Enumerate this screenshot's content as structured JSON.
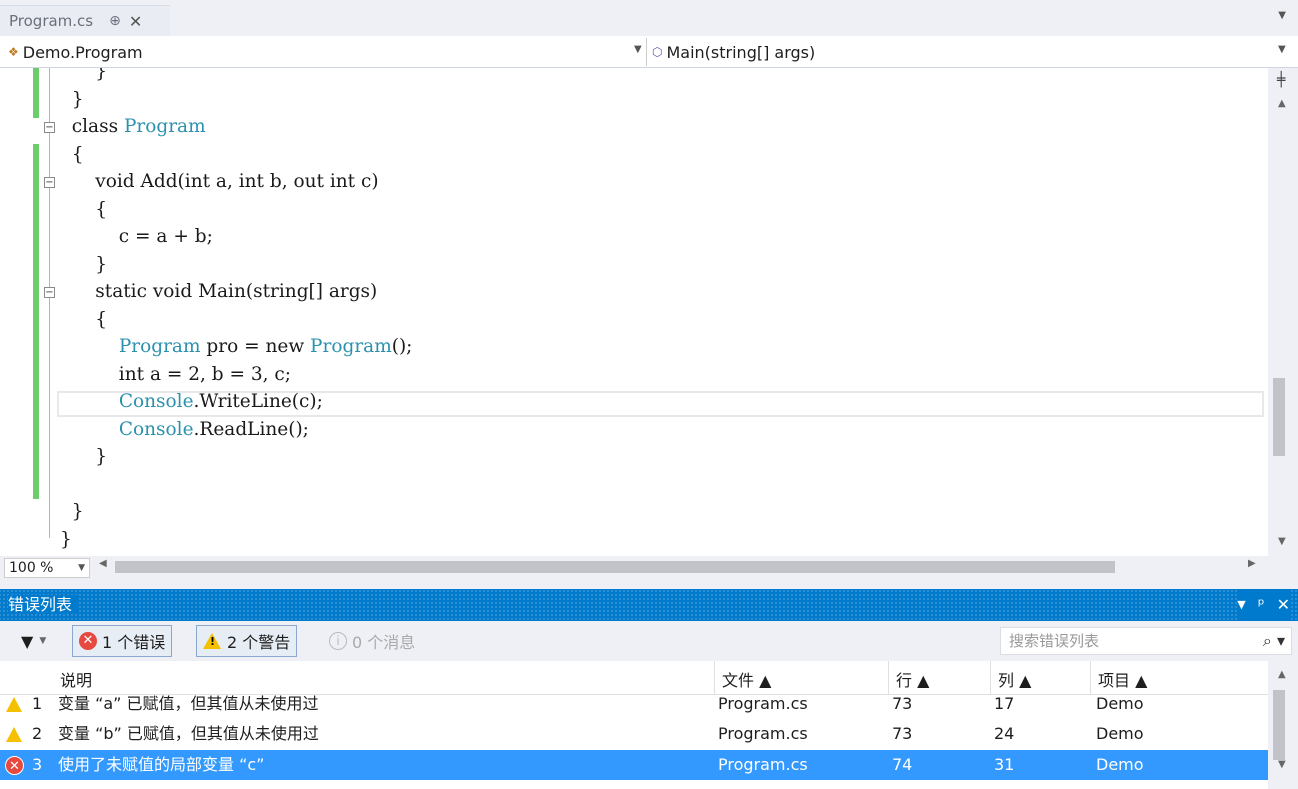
{
  "tab": {
    "title": "Program.cs",
    "pin": "⊕",
    "close": "✕"
  },
  "nav": {
    "class_selector": "Demo.Program",
    "member_selector": "Main(string[] args)"
  },
  "code_lines": [
    "      }",
    "  }",
    "  class Program",
    "  {",
    "      void Add(int a, int b, out int c)",
    "      {",
    "          c = a + b;",
    "      }",
    "      static void Main(string[] args)",
    "      {",
    "          Program pro = new Program();",
    "          int a = 2, b = 3, c;",
    "          Console.WriteLine(c);",
    "          Console.ReadLine();",
    "      }",
    "",
    "  }",
    "}"
  ],
  "editor": {
    "zoom": "100 %"
  },
  "error_list": {
    "title": "错误列表",
    "errors_label": "1 个错误",
    "warnings_label": "2 个警告",
    "messages_label": "0 个消息",
    "search_placeholder": "搜索错误列表",
    "columns": {
      "desc": "说明",
      "file": "文件 ▲",
      "line": "行 ▲",
      "col": "列 ▲",
      "project": "项目 ▲"
    },
    "rows": [
      {
        "kind": "warning",
        "num": "1",
        "desc": "变量 “a” 已赋值，但其值从未使用过",
        "file": "Program.cs",
        "line": "73",
        "col": "17",
        "project": "Demo"
      },
      {
        "kind": "warning",
        "num": "2",
        "desc": "变量 “b” 已赋值，但其值从未使用过",
        "file": "Program.cs",
        "line": "73",
        "col": "24",
        "project": "Demo"
      },
      {
        "kind": "error",
        "num": "3",
        "desc": "使用了未赋值的局部变量 “c”",
        "file": "Program.cs",
        "line": "74",
        "col": "31",
        "project": "Demo"
      }
    ]
  }
}
